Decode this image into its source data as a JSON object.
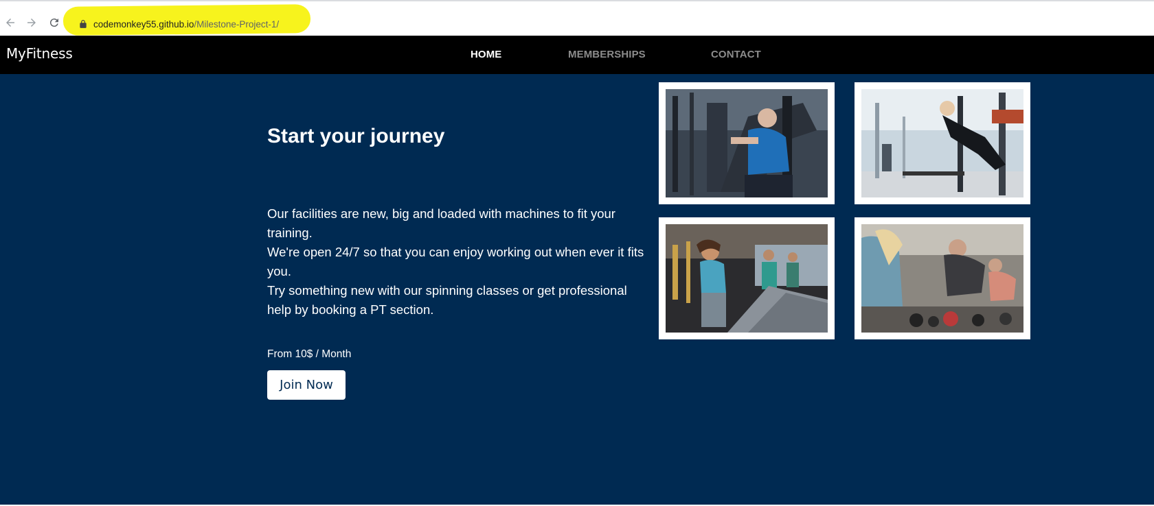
{
  "browser": {
    "url_host": "codemonkey55.github.io",
    "url_path": "/Milestone-Project-1/",
    "highlight_color": "#f7f31d",
    "icons": [
      "back-arrow-icon",
      "forward-arrow-icon",
      "reload-icon",
      "lock-icon"
    ]
  },
  "navbar": {
    "brand": "MyFitness",
    "links": [
      {
        "label": "HOME",
        "active": true
      },
      {
        "label": "MEMBERSHIPS",
        "active": false
      },
      {
        "label": "CONTACT",
        "active": false
      }
    ]
  },
  "hero": {
    "title": "Start your journey",
    "paragraphs": [
      "Our facilities are new, big and loaded with machines to fit your training.",
      "We're open 24/7 so that you can enjoy working out when ever it fits you.",
      "Try something new with our spinning classes or get professional help by booking a PT section."
    ],
    "price": "From 10$ / Month",
    "cta_label": "Join Now",
    "background_color": "#002a52"
  },
  "photos": [
    {
      "subject": "senior man on chest press machine"
    },
    {
      "subject": "woman exercising on gym equipment"
    },
    {
      "subject": "woman running on treadmill"
    },
    {
      "subject": "group doing push-ups with kettlebells"
    }
  ]
}
